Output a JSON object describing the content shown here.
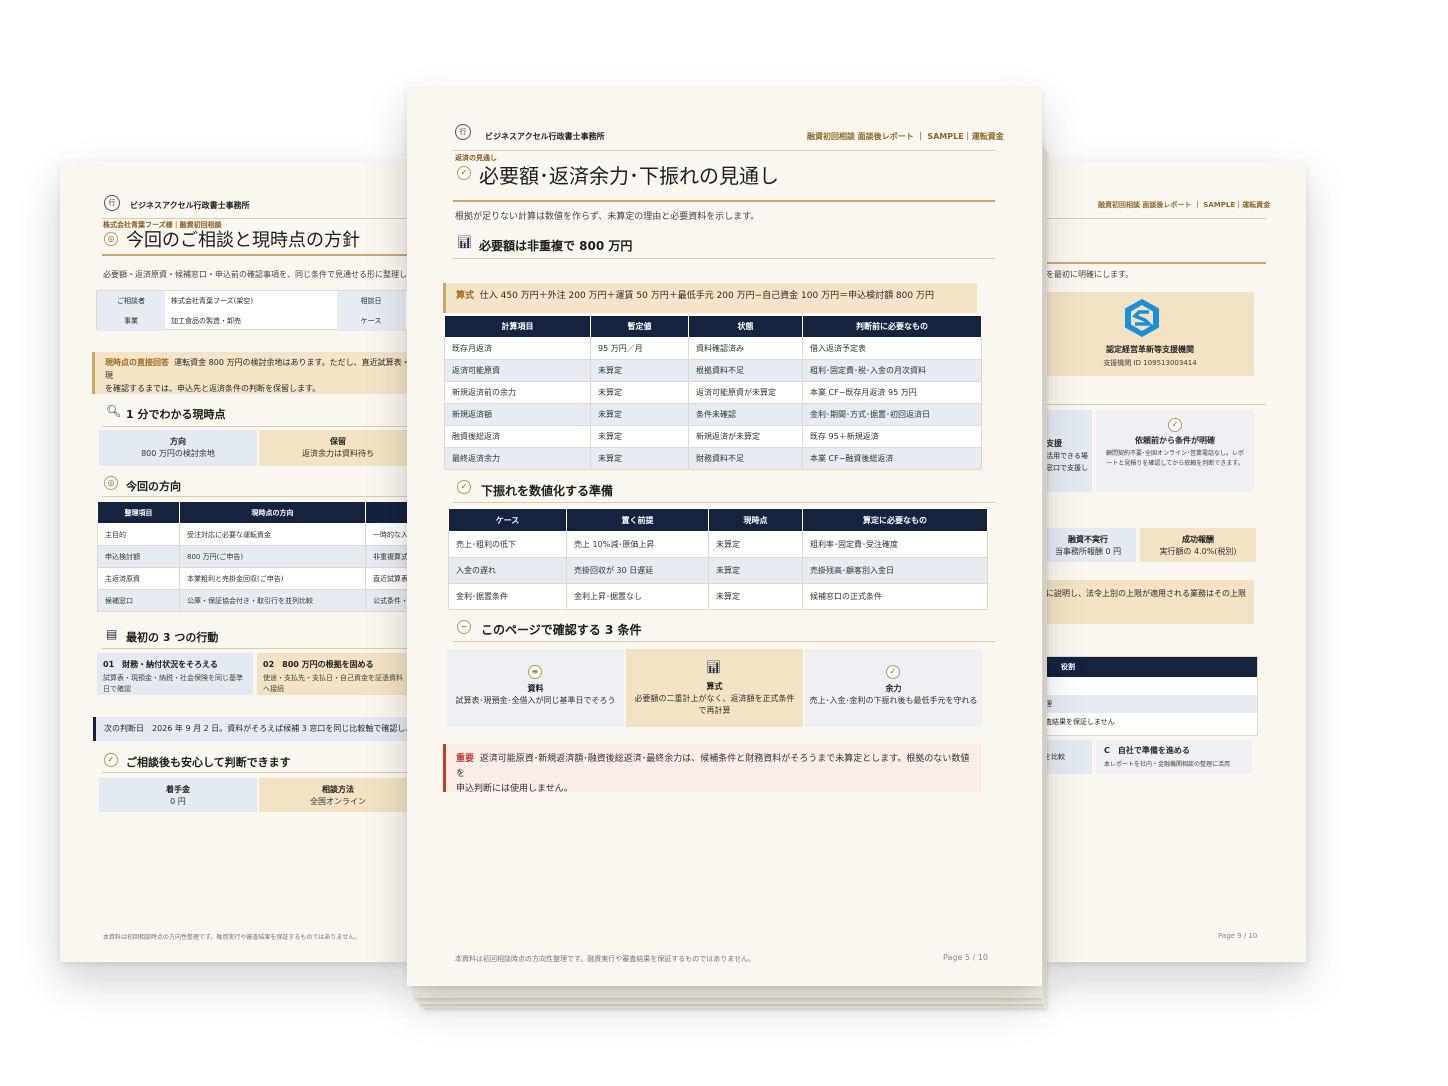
{
  "left": {
    "firm": "ビジネスアクセル行政書士事務所",
    "eyebrow": "株式会社青葉フーズ様｜融資初回相談",
    "title": "今回のご相談と現時点の方針",
    "lead": "必要額・返済原資・候補窓口・申込前の確認事項を、同じ条件で見通せる形に整理し",
    "info": {
      "row1_k": "ご相談者",
      "row1_v": "株式会社青葉フーズ(架空)",
      "row1_k2": "相談日",
      "row2_k": "事業",
      "row2_v": "加工食品の製造・卸売",
      "row2_k2": "ケース"
    },
    "callout_label": "現時点の直接回答",
    "callout_text1": "運転資金 800 万円の検討余地はあります。ただし、直近試算表・現",
    "callout_text2": "を確認するまでは、申込先と返済条件の判断を保留します。",
    "sec1": "1 分でわかる現時点",
    "s1a_t": "方向",
    "s1a_v": "800 万円の検討余地",
    "s1b_t": "保留",
    "s1b_v": "返済余力は資料待ち",
    "sec2": "今回の方向",
    "t2_head": [
      "整理項目",
      "現時点の方向",
      ""
    ],
    "t2_rows": [
      [
        "主目的",
        "受注対応に必要な運転資金",
        "一時的な入"
      ],
      [
        "申込検討額",
        "800 万円(ご申告)",
        "非重複算式"
      ],
      [
        "主返済原資",
        "本業粗利と売掛金回収(ご申告)",
        "直近試算表"
      ],
      [
        "候補窓口",
        "公庫・保証協会付き・取引行を並列比較",
        "公式条件・E"
      ]
    ],
    "sec3": "最初の 3 つの行動",
    "a1_t": "01　財務・納付状況をそろえる",
    "a1_v": "試算表・現預金・納税・社会保険を同じ基準日で確認",
    "a2_t": "02　800 万円の根拠を固める",
    "a2_v": "使途・支払先・支払日・自己資金を証憑資料へ接続",
    "next": "次の判断日　2026 年 9 月 2 日。資料がそろえば候補 3 窓口を同じ比較軸で確認し、",
    "sec4": "ご相談後も安心して判断できます",
    "f1_t": "着手金",
    "f1_v": "0 円",
    "f2_t": "相談方法",
    "f2_v": "全国オンライン",
    "footer": "本資料は初回相談時点の方向性整理です。融資実行や審査結果を保証するものではありません。"
  },
  "right": {
    "hdr": "融資初回相談 面談後レポート ｜ SAMPLE｜運転資金",
    "lead": "を最初に明確にします。",
    "org": "認定経営革新等支援機関",
    "org_id": "支援機関 ID 109513003414",
    "b1_t": "支援",
    "b1_v1": "活用できる場",
    "b1_v2": "窓口で支援し",
    "b2_t": "依頼前から条件が明確",
    "b2_v": "顧問契約不要･全国オンライン･営業電話なし。レポートと見積りを確認してから依頼を判断できます。",
    "c1_t": "融資不実行",
    "c1_v": "当事務所報酬 0 円",
    "c2_t": "成功報酬",
    "c2_v": "実行額の 4.0%(税別)",
    "note": "に説明し、法令上別の上限が適用される業務はその上限",
    "t_head": "役割",
    "t_r2": "理",
    "t_r3": "査結果を保証しません",
    "o1": "を比較",
    "o2_t": "C　自社で準備を進める",
    "o2_v": "本レポートを社内・金融機関相談の整理に活用",
    "pageno": "Page 9 / 10"
  },
  "center": {
    "firm": "ビジネスアクセル行政書士事務所",
    "hdr": "融資初回相談 面談後レポート ｜ SAMPLE｜運転資金",
    "eyebrow": "返済の見通し",
    "title": "必要額･返済余力･下振れの見通し",
    "lead": "根拠が足りない計算は数値を作らず、未算定の理由と必要資料を示します。",
    "sec1": "必要額は非重複で 800 万円",
    "formula_label": "算式",
    "formula": "仕入 450 万円＋外注 200 万円＋運賃 50 万円＋最低手元 200 万円−自己資金 100 万円＝申込検討額 800 万円",
    "t1_head": [
      "計算項目",
      "暫定値",
      "状態",
      "判断前に必要なもの"
    ],
    "t1_rows": [
      [
        "既存月返済",
        "95 万円／月",
        "資料確認済み",
        "借入返済予定表"
      ],
      [
        "返済可能原資",
        "未算定",
        "根拠資料不足",
        "粗利･固定費･税･入金の月次資料"
      ],
      [
        "新規返済前の余力",
        "未算定",
        "返済可能原資が未算定",
        "本業 CF−既存月返済 95 万円"
      ],
      [
        "新規返済額",
        "未算定",
        "条件未確認",
        "金利･期間･方式･据置･初回返済日"
      ],
      [
        "融資後総返済",
        "未算定",
        "新規返済が未算定",
        "既存 95＋新規返済"
      ],
      [
        "最終返済余力",
        "未算定",
        "財務資料不足",
        "本業 CF−融資後総返済"
      ]
    ],
    "sec2": "下振れを数値化する準備",
    "t2_head": [
      "ケース",
      "置く前提",
      "現時点",
      "算定に必要なもの"
    ],
    "t2_rows": [
      [
        "売上･粗利の低下",
        "売上 10%減･原価上昇",
        "未算定",
        "粗利率･固定費･受注確度"
      ],
      [
        "入金の遅れ",
        "売掛回収が 30 日遅延",
        "未算定",
        "売掛残高･顧客別入金日"
      ],
      [
        "金利･据置条件",
        "金利上昇･据置なし",
        "未算定",
        "候補窓口の正式条件"
      ]
    ],
    "sec3": "このページで確認する 3 条件",
    "k1_t": "資料",
    "k1_v": "試算表･現預金･全借入が同じ基準日でそろう",
    "k2_t": "算式",
    "k2_v": "必要額の二重計上がなく、返済額を正式条件で再計算",
    "k3_t": "余力",
    "k3_v": "売上･入金･金利の下振れ後も最低手元を守れる",
    "warn_label": "重要",
    "warn_text1": "返済可能原資･新規返済額･融資後総返済･最終余力は、候補条件と財務資料がそろうまで未算定とします。根拠のない数値を",
    "warn_text2": "申込判断には使用しません。",
    "footer": "本資料は初回相談時点の方向性整理です。融資実行や審査結果を保証するものではありません。",
    "pageno": "Page 5 / 10"
  }
}
